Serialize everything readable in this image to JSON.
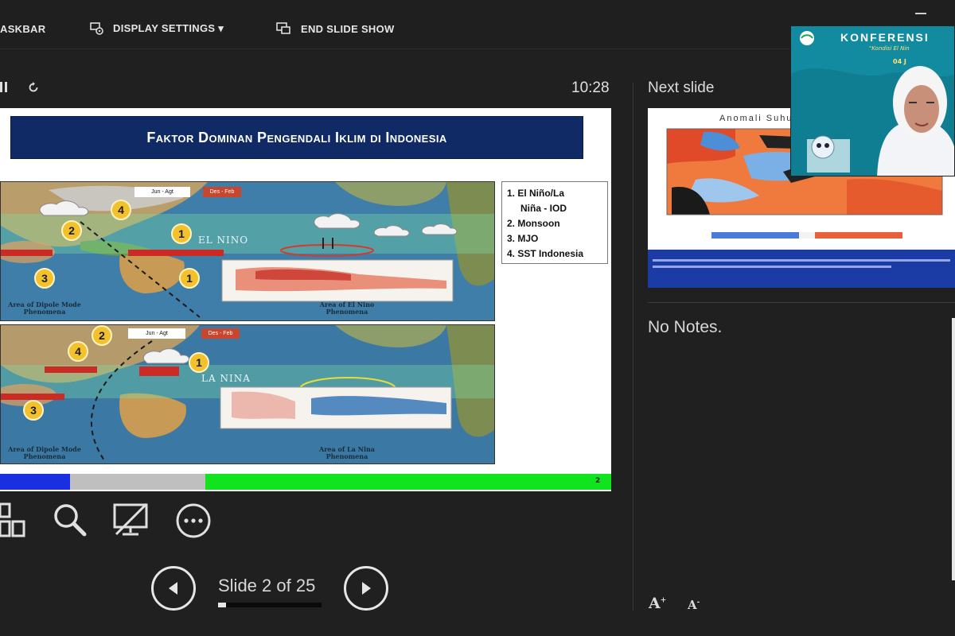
{
  "toolbar": {
    "taskbar_label": "ASKBAR",
    "display_settings_label": "DISPLAY SETTINGS ▾",
    "end_show_label": "END SLIDE SHOW"
  },
  "presenter": {
    "timer": "10:28",
    "slide_counter": "Slide 2 of 25",
    "progress_fraction": 0.08
  },
  "current_slide": {
    "title": "Faktor Dominan Pengendali Iklim di Indonesia",
    "page_number": "2",
    "map1": {
      "label": "EL NINO",
      "caption_left": "Area of Dipole Mode Phenomena",
      "caption_right": "Area of El Nino Phenomena",
      "tag_white": "Jun - Agt",
      "tag_red": "Des - Feb"
    },
    "map2": {
      "label": "LA NINA",
      "caption_left": "Area of Dipole Mode Phenomena",
      "caption_right": "Area of La Nina Phenomena",
      "tag_white": "Jun - Agt",
      "tag_red": "Des - Feb"
    },
    "legend": [
      "1. El Niño/La",
      "Niña - IOD",
      "2. Monsoon",
      "3. MJO",
      "4. SST Indonesia"
    ]
  },
  "next_slide": {
    "panel_label": "Next slide",
    "title": "Anomali Suhu Mu"
  },
  "notes": {
    "text": "No Notes."
  },
  "webcam": {
    "banner": "KONFERENSI",
    "subtitle": "\"Kondisi El Nin",
    "date": "04 J"
  },
  "colors": {
    "background": "#202020",
    "slide_title_bg": "#0f2a64",
    "bar_blue": "#1a2fe0",
    "bar_gray": "#bfbfbf",
    "bar_green": "#11e41f",
    "next_footer": "#1b3ba5"
  }
}
